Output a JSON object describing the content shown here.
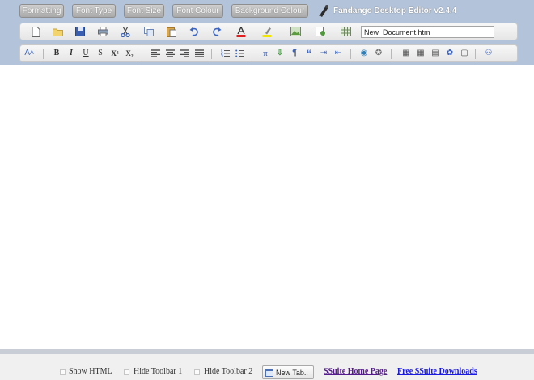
{
  "menu": {
    "formatting": "Formatting",
    "font_type": "Font Type",
    "font_size": "Font Size",
    "font_colour": "Font Colour",
    "background_colour": "Background Colour"
  },
  "app_title": "Fandango Desktop Editor v2.4.4",
  "toolbar1": {
    "filename": "New_Document.htm",
    "icons": {
      "new": "📄",
      "open": "📁",
      "save": "💾",
      "print": "🖨",
      "cut": "✂",
      "copy": "❐",
      "paste": "📋",
      "undo": "↶",
      "redo": "↷",
      "font_color": "A",
      "highlight": "✎",
      "insert_image": "▦",
      "insert_link": "▤",
      "insert_table": "▦"
    }
  },
  "toolbar2": {
    "icons": {
      "text_style": "A",
      "bold": "B",
      "italic": "I",
      "underline": "U",
      "strike": "S",
      "superscript": "X²",
      "subscript": "X₂",
      "align_left": "≡",
      "align_center": "≡",
      "align_right": "≡",
      "justify": "≡",
      "ordered_list": "☰",
      "unordered_list": "☰",
      "pi": "π",
      "download": "⇩",
      "paragraph": "¶",
      "quote": "“",
      "indent": "⇥",
      "outdent": "⇤",
      "globe": "◉",
      "gear": "✪",
      "grid1": "▦",
      "grid2": "▦",
      "grid3": "▤",
      "grid4": "✿",
      "page": "▢",
      "find": "⚇"
    }
  },
  "bottom": {
    "show_html": "Show HTML",
    "hide_toolbar1": "Hide Toolbar 1",
    "hide_toolbar2": "Hide Toolbar 2",
    "new_tab": "New Tab..",
    "home_link": "SSuite Home Page",
    "downloads_link": "Free SSuite Downloads"
  }
}
